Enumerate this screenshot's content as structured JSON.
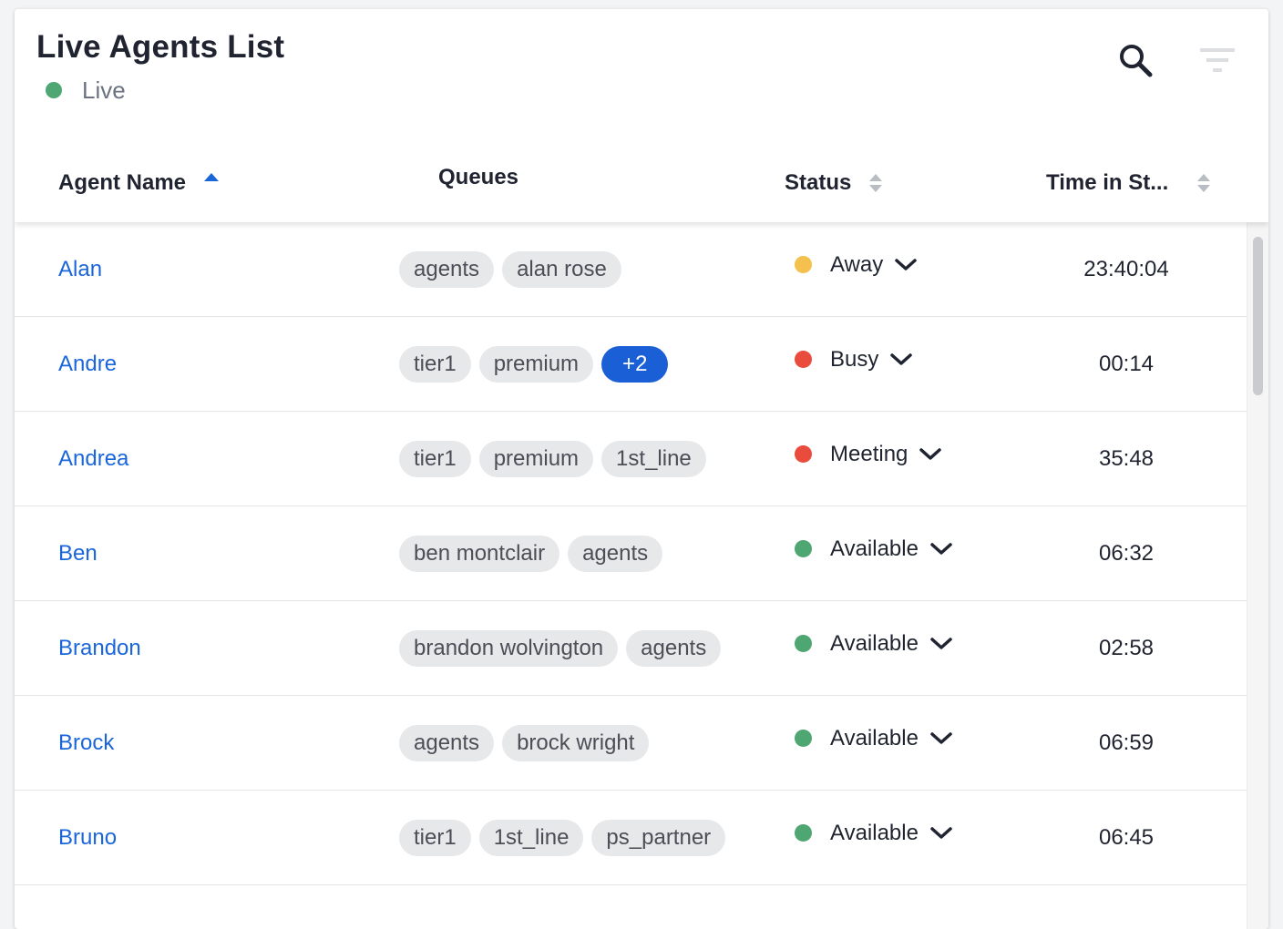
{
  "header": {
    "title": "Live Agents List",
    "live_label": "Live",
    "live_color": "#4ea672",
    "search_icon": "search-icon",
    "filter_icon": "filter-icon"
  },
  "columns": {
    "agent_name": "Agent Name",
    "queues": "Queues",
    "status": "Status",
    "time_in_status": "Time in St..."
  },
  "status_colors": {
    "Away": "#f4c04e",
    "Busy": "#e94b3c",
    "Meeting": "#e94b3c",
    "Available": "#4ea672"
  },
  "agents": [
    {
      "name": "Alan",
      "queues": [
        "agents",
        "alan rose"
      ],
      "more": null,
      "status": "Away",
      "time": "23:40:04"
    },
    {
      "name": "Andre",
      "queues": [
        "tier1",
        "premium"
      ],
      "more": "+2",
      "status": "Busy",
      "time": "00:14"
    },
    {
      "name": "Andrea",
      "queues": [
        "tier1",
        "premium",
        "1st_line"
      ],
      "more": null,
      "status": "Meeting",
      "time": "35:48"
    },
    {
      "name": "Ben",
      "queues": [
        "ben montclair",
        "agents"
      ],
      "more": null,
      "status": "Available",
      "time": "06:32"
    },
    {
      "name": "Brandon",
      "queues": [
        "brandon wolvington",
        "agents"
      ],
      "more": null,
      "status": "Available",
      "time": "02:58"
    },
    {
      "name": "Brock",
      "queues": [
        "agents",
        "brock wright"
      ],
      "more": null,
      "status": "Available",
      "time": "06:59"
    },
    {
      "name": "Bruno",
      "queues": [
        "tier1",
        "1st_line",
        "ps_partner"
      ],
      "more": null,
      "status": "Available",
      "time": "06:45"
    }
  ]
}
